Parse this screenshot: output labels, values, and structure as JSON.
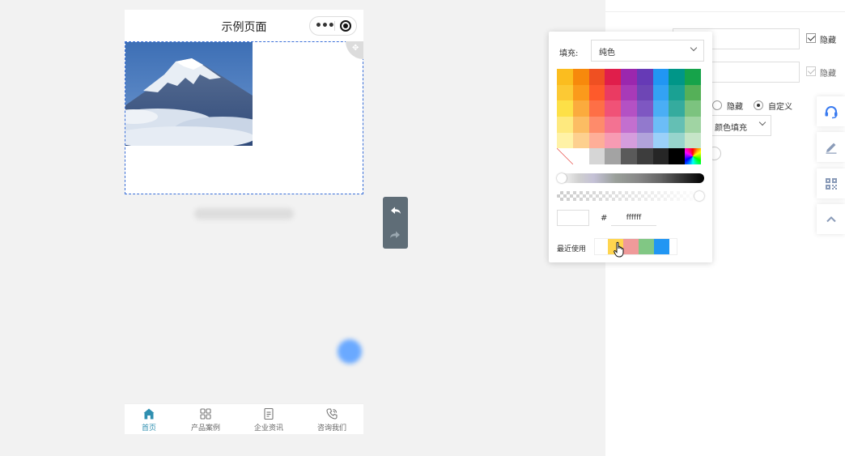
{
  "phone": {
    "title": "示例页面",
    "capsule_more": "•••",
    "tabs": [
      {
        "label": "首页",
        "icon": "home-icon",
        "active": true
      },
      {
        "label": "产品案例",
        "icon": "grid-icon",
        "active": false
      },
      {
        "label": "企业资讯",
        "icon": "document-icon",
        "active": false
      },
      {
        "label": "咨询我们",
        "icon": "phone-icon",
        "active": false
      }
    ]
  },
  "panel": {
    "hide_label": "隐藏",
    "radio_hide": "隐藏",
    "radio_custom": "自定义",
    "fill_type": "颜色填充"
  },
  "picker": {
    "fill_label": "填充:",
    "fill_value": "纯色",
    "hash": "#",
    "hex_value": "ffffff",
    "recent_label": "最近使用",
    "swatches": [
      [
        "#fbbd1f",
        "#f7890c",
        "#ef5022",
        "#e01e4b",
        "#9b27ae",
        "#663ab6",
        "#2196f3",
        "#009688",
        "#16a34a"
      ],
      [
        "#fcc934",
        "#fb9a1b",
        "#fe5a2b",
        "#ea3b62",
        "#a83ab8",
        "#6e46b5",
        "#33a2f4",
        "#1aa193",
        "#55b058"
      ],
      [
        "#fde047",
        "#fbab3d",
        "#fe6f46",
        "#f05277",
        "#b451c4",
        "#7e57c2",
        "#4aaef5",
        "#35ab9e",
        "#7cc37f"
      ],
      [
        "#fee97e",
        "#fcbd63",
        "#fe8b6b",
        "#f37292",
        "#c36fcf",
        "#9279cd",
        "#6cbdf7",
        "#64bfb4",
        "#a0d4a3"
      ],
      [
        "#fff2a6",
        "#fdd08f",
        "#feae98",
        "#f79bb3",
        "#d59ddd",
        "#b1a3db",
        "#9bd0f9",
        "#97d4cc",
        "#c6e5c8"
      ],
      [
        "none",
        "#ffffff",
        "#d6d6d6",
        "#a3a3a3",
        "#5a5a5a",
        "#3d3d3d",
        "#262626",
        "#000000",
        "rainbow"
      ]
    ],
    "recent_colors": [
      "#ffd54f",
      "#ef9a9a",
      "#81c784",
      "#2196f3"
    ]
  }
}
